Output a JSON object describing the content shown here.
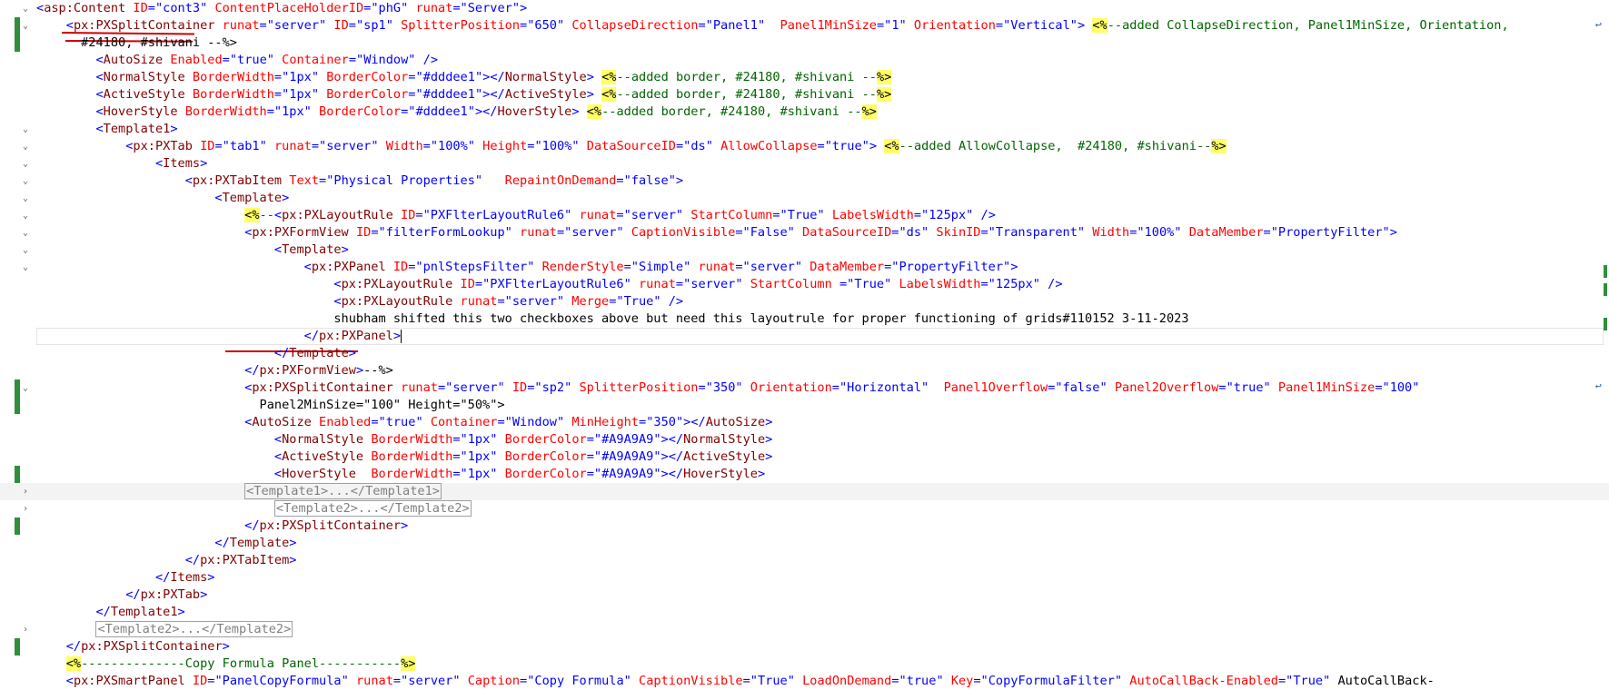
{
  "editor": {
    "lines": [
      "<asp:Content ID=\"cont3\" ContentPlaceHolderID=\"phG\" runat=\"Server\">",
      "    <px:PXSplitContainer runat=\"server\" ID=\"sp1\" SplitterPosition=\"650\" CollapseDirection=\"Panel1\"  Panel1MinSize=\"1\" Orientation=\"Vertical\"> <%--added CollapseDirection, Panel1MinSize, Orientation,",
      "      #24180, #shivani --%>",
      "        <AutoSize Enabled=\"true\" Container=\"Window\" />",
      "        <NormalStyle BorderWidth=\"1px\" BorderColor=\"#dddee1\"></NormalStyle> <%--added border, #24180, #shivani --%>",
      "        <ActiveStyle BorderWidth=\"1px\" BorderColor=\"#dddee1\"></ActiveStyle> <%--added border, #24180, #shivani --%>",
      "        <HoverStyle BorderWidth=\"1px\" BorderColor=\"#dddee1\"></HoverStyle> <%--added border, #24180, #shivani --%>",
      "        <Template1>",
      "            <px:PXTab ID=\"tab1\" runat=\"server\" Width=\"100%\" Height=\"100%\" DataSourceID=\"ds\" AllowCollapse=\"true\"> <%--added AllowCollapse,  #24180, #shivani--%>",
      "                <Items>",
      "                    <px:PXTabItem Text=\"Physical Properties\"   RepaintOnDemand=\"false\">",
      "                        <Template>",
      "                            <%--<px:PXLayoutRule ID=\"PXFlterLayoutRule6\" runat=\"server\" StartColumn=\"True\" LabelsWidth=\"125px\" />",
      "                            <px:PXFormView ID=\"filterFormLookup\" runat=\"server\" CaptionVisible=\"False\" DataSourceID=\"ds\" SkinID=\"Transparent\" Width=\"100%\" DataMember=\"PropertyFilter\">",
      "                                <Template>",
      "                                    <px:PXPanel ID=\"pnlStepsFilter\" RenderStyle=\"Simple\" runat=\"server\" DataMember=\"PropertyFilter\">",
      "                                        <px:PXLayoutRule ID=\"PXFlterLayoutRule6\" runat=\"server\" StartColumn =\"True\" LabelsWidth=\"125px\" />",
      "                                        <px:PXLayoutRule runat=\"server\" Merge=\"True\" />",
      "                                        shubham shifted this two checkboxes above but need this layoutrule for proper functioning of grids#110152 3-11-2023",
      "                                    </px:PXPanel>",
      "                                </Template>",
      "                            </px:PXFormView>--%>",
      "                            <px:PXSplitContainer runat=\"server\" ID=\"sp2\" SplitterPosition=\"350\" Orientation=\"Horizontal\"  Panel1Overflow=\"false\" Panel2Overflow=\"true\" Panel1MinSize=\"100\"",
      "                              Panel2MinSize=\"100\" Height=\"50%\">",
      "                            <AutoSize Enabled=\"true\" Container=\"Window\" MinHeight=\"350\"></AutoSize>",
      "                                <NormalStyle BorderWidth=\"1px\" BorderColor=\"#A9A9A9\"></NormalStyle>",
      "                                <ActiveStyle BorderWidth=\"1px\" BorderColor=\"#A9A9A9\"></ActiveStyle>",
      "                                <HoverStyle  BorderWidth=\"1px\" BorderColor=\"#A9A9A9\"></HoverStyle>",
      "                            <Template1>...</Template1>",
      "                                <Template2>...</Template2>",
      "                            </px:PXSplitContainer>",
      "                        </Template>",
      "                    </px:PXTabItem>",
      "                </Items>",
      "            </px:PXTab>",
      "        </Template1>",
      "        <Template2>...</Template2>",
      "    </px:PXSplitContainer>",
      "    <%--------------Copy Formula Panel-----------%>",
      "    <px:PXSmartPanel ID=\"PanelCopyFormula\" runat=\"server\" Caption=\"Copy Formula\" CaptionVisible=\"True\" LoadOnDemand=\"true\" Key=\"CopyFormulaFilter\" AutoCallBack-Enabled=\"True\" AutoCallBack-"
    ],
    "collapsed_lines": [
      28,
      29,
      36
    ],
    "current_line": 19,
    "highlight_lines": [
      28
    ],
    "fold_open_lines": [
      0,
      1,
      7,
      8,
      9,
      10,
      11,
      12,
      13,
      14,
      15,
      22
    ],
    "fold_closed_lines": [
      28,
      29,
      36
    ],
    "change_lines": [
      1,
      2,
      22,
      23,
      27,
      30,
      37
    ],
    "colors": {
      "tag": "#800000",
      "attribute": "#ff0000",
      "value": "#0000ff",
      "comment": "#006400",
      "asp_delim_bg": "#ffff66",
      "change_bar": "#2f8f3a",
      "underline": "#d00000"
    }
  }
}
